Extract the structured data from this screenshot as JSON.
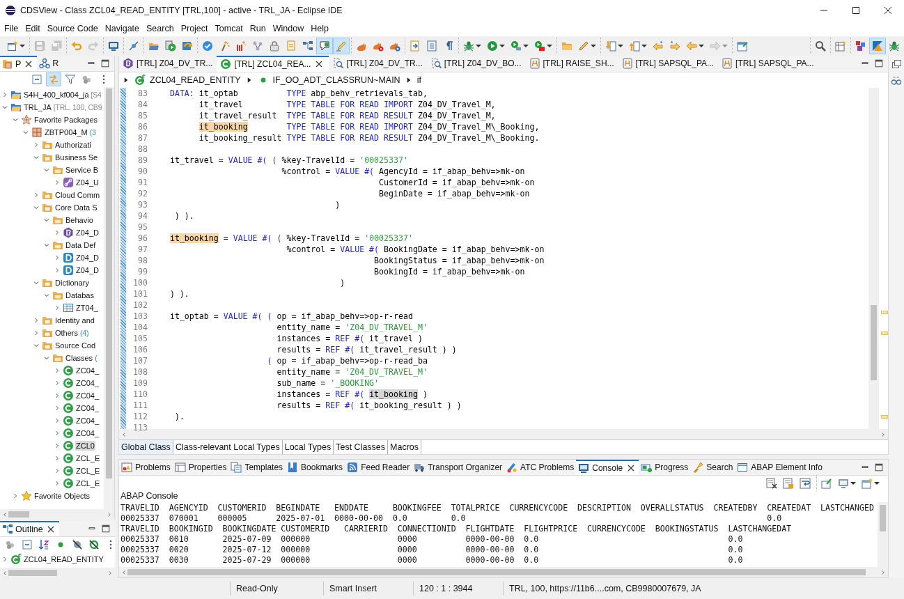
{
  "window": {
    "title": "CDSView - Class ZCL04_READ_ENTITY [TRL,100] - active - TRL_JA - Eclipse IDE"
  },
  "menu": [
    "File",
    "Edit",
    "Source Code",
    "Navigate",
    "Search",
    "Project",
    "Tomcat",
    "Run",
    "Window",
    "Help"
  ],
  "toolbar": {
    "left": [
      [
        {
          "kind": "new",
          "dropdown": true,
          "pressed": false,
          "disabled": false
        }
      ],
      [
        {
          "kind": "save",
          "dropdown": false,
          "pressed": false,
          "disabled": true
        },
        {
          "kind": "saveall",
          "dropdown": false,
          "pressed": false,
          "disabled": true
        }
      ],
      [
        {
          "kind": "undo",
          "dropdown": false,
          "pressed": false,
          "disabled": false
        },
        {
          "kind": "redo",
          "dropdown": false,
          "pressed": false,
          "disabled": true
        }
      ],
      [
        {
          "kind": "monitor",
          "dropdown": false,
          "pressed": false,
          "disabled": false
        }
      ],
      [
        {
          "kind": "link",
          "dropdown": false,
          "pressed": false,
          "disabled": false
        }
      ],
      [
        {
          "kind": "open",
          "dropdown": false,
          "pressed": false,
          "disabled": false
        },
        {
          "kind": "run",
          "dropdown": false,
          "pressed": false,
          "disabled": false
        },
        {
          "kind": "refresh",
          "dropdown": false,
          "pressed": false,
          "disabled": false
        }
      ],
      [
        {
          "kind": "check",
          "dropdown": false,
          "pressed": false,
          "disabled": false
        },
        {
          "kind": "wand",
          "dropdown": false,
          "pressed": false,
          "disabled": false
        },
        {
          "kind": "sparkle",
          "dropdown": false,
          "pressed": false,
          "disabled": false
        },
        {
          "kind": "cycle",
          "dropdown": false,
          "pressed": false,
          "disabled": false
        },
        {
          "kind": "lock",
          "dropdown": false,
          "pressed": false,
          "disabled": false
        },
        {
          "kind": "swap",
          "dropdown": false,
          "pressed": false,
          "disabled": false
        },
        {
          "kind": "hierarchy",
          "dropdown": false,
          "pressed": false,
          "disabled": false
        },
        {
          "kind": "comment",
          "dropdown": false,
          "pressed": true,
          "disabled": false
        },
        {
          "kind": "highlighter",
          "dropdown": false,
          "pressed": true,
          "disabled": false
        }
      ],
      [
        {
          "kind": "cat",
          "dropdown": false,
          "pressed": false,
          "disabled": false
        },
        {
          "kind": "catx",
          "dropdown": false,
          "pressed": false,
          "disabled": false
        },
        {
          "kind": "catr",
          "dropdown": false,
          "pressed": false,
          "disabled": false
        }
      ],
      [
        {
          "kind": "doc",
          "dropdown": false,
          "pressed": false,
          "disabled": false
        },
        {
          "kind": "listdoc",
          "dropdown": false,
          "pressed": false,
          "disabled": false
        },
        {
          "kind": "pilcrow",
          "dropdown": false,
          "pressed": false,
          "disabled": false
        }
      ],
      [
        {
          "kind": "bug",
          "dropdown": true,
          "pressed": false,
          "disabled": false
        },
        {
          "kind": "play",
          "dropdown": true,
          "pressed": false,
          "disabled": false
        },
        {
          "kind": "runlist",
          "dropdown": true,
          "pressed": false,
          "disabled": false
        },
        {
          "kind": "runbox",
          "dropdown": true,
          "pressed": false,
          "disabled": false
        }
      ],
      [
        {
          "kind": "folder",
          "dropdown": false,
          "pressed": false,
          "disabled": false
        },
        {
          "kind": "pen",
          "dropdown": true,
          "pressed": false,
          "disabled": false
        }
      ],
      [
        {
          "kind": "down",
          "dropdown": true,
          "pressed": false,
          "disabled": false
        },
        {
          "kind": "up",
          "dropdown": true,
          "pressed": false,
          "disabled": false
        },
        {
          "kind": "backstar",
          "dropdown": false,
          "pressed": false,
          "disabled": false
        },
        {
          "kind": "fwdstar",
          "dropdown": false,
          "pressed": false,
          "disabled": false
        },
        {
          "kind": "back",
          "dropdown": true,
          "pressed": false,
          "disabled": false
        },
        {
          "kind": "fwd",
          "dropdown": true,
          "pressed": false,
          "disabled": true
        }
      ],
      [
        {
          "kind": "pinwin",
          "dropdown": false,
          "pressed": false,
          "disabled": false
        }
      ]
    ],
    "right": [
      [
        {
          "kind": "search",
          "dropdown": false,
          "pressed": false,
          "disabled": false
        }
      ],
      [
        {
          "kind": "perspopen",
          "dropdown": false,
          "pressed": false,
          "disabled": false
        }
      ],
      [
        {
          "kind": "cubes",
          "dropdown": false,
          "pressed": false,
          "disabled": false
        },
        {
          "kind": "triangle",
          "dropdown": false,
          "pressed": true,
          "disabled": false
        },
        {
          "kind": "bug",
          "dropdown": false,
          "pressed": false,
          "disabled": false
        }
      ]
    ]
  },
  "left_panel": {
    "tabs": [
      {
        "label": "P",
        "kind": "packages",
        "selected": true
      },
      {
        "label": "R",
        "kind": "relations",
        "selected": false
      }
    ],
    "toolbar": [
      {
        "kind": "collapse",
        "pressed": false
      },
      {
        "kind": "linked",
        "pressed": true
      },
      {
        "kind": "filter",
        "pressed": false
      },
      {
        "kind": "circles",
        "pressed": false
      },
      {
        "kind": "more",
        "pressed": false
      }
    ],
    "tree": [
      {
        "label": "S4H_400_kf004_ja",
        "detail": "[S4",
        "kind": "project",
        "expanded": false,
        "selected": false
      },
      {
        "label": "TRL_JA",
        "detail": "[TRL, 100, CB9",
        "kind": "project",
        "expanded": true,
        "selected": false,
        "children": [
          {
            "label": "Favorite Packages",
            "kind": "favorites",
            "expanded": true,
            "selected": false,
            "children": [
              {
                "label": "ZBTP004_M",
                "detail": "(3",
                "kind": "package",
                "expanded": true,
                "selected": false,
                "children": [
                  {
                    "label": "Authorizati",
                    "kind": "gfolder",
                    "expanded": false,
                    "selected": false
                  },
                  {
                    "label": "Business Se",
                    "kind": "gfolder",
                    "expanded": true,
                    "selected": false,
                    "children": [
                      {
                        "label": "Service B",
                        "kind": "tfolder",
                        "expanded": true,
                        "selected": false,
                        "children": [
                          {
                            "label": "Z04_U",
                            "kind": "service",
                            "expanded": false,
                            "selected": false
                          }
                        ]
                      }
                    ]
                  },
                  {
                    "label": "Cloud Comm",
                    "kind": "gfolder",
                    "expanded": false,
                    "selected": false
                  },
                  {
                    "label": "Core Data S",
                    "kind": "gfolder",
                    "expanded": true,
                    "selected": false,
                    "children": [
                      {
                        "label": "Behavio",
                        "kind": "tfolder",
                        "expanded": true,
                        "selected": false,
                        "children": [
                          {
                            "label": "Z04_D",
                            "kind": "behavior",
                            "expanded": false,
                            "selected": false
                          }
                        ]
                      },
                      {
                        "label": "Data Def",
                        "kind": "tfolder",
                        "expanded": true,
                        "selected": false,
                        "children": [
                          {
                            "label": "Z04_D",
                            "kind": "ddl",
                            "expanded": false,
                            "selected": false
                          },
                          {
                            "label": "Z04_D",
                            "kind": "ddl",
                            "expanded": false,
                            "selected": false
                          }
                        ]
                      }
                    ]
                  },
                  {
                    "label": "Dictionary",
                    "kind": "gfolder",
                    "expanded": true,
                    "selected": false,
                    "children": [
                      {
                        "label": "Databas",
                        "kind": "tfolder",
                        "expanded": true,
                        "selected": false,
                        "children": [
                          {
                            "label": "ZT04_",
                            "kind": "table",
                            "expanded": false,
                            "selected": false
                          }
                        ]
                      }
                    ]
                  },
                  {
                    "label": "Identity and",
                    "kind": "gfolder",
                    "expanded": false,
                    "selected": false
                  },
                  {
                    "label": "Others",
                    "detail": "(4)",
                    "kind": "gfolder",
                    "expanded": false,
                    "selected": false
                  },
                  {
                    "label": "Source Cod",
                    "kind": "gfolder",
                    "expanded": true,
                    "selected": false,
                    "children": [
                      {
                        "label": "Classes",
                        "detail": "(",
                        "kind": "tfolder",
                        "expanded": true,
                        "selected": false,
                        "children": [
                          {
                            "label": "ZC04_",
                            "kind": "class",
                            "expanded": false,
                            "selected": false
                          },
                          {
                            "label": "ZC04_",
                            "kind": "class",
                            "expanded": false,
                            "selected": false
                          },
                          {
                            "label": "ZC04_",
                            "kind": "class",
                            "expanded": false,
                            "selected": false
                          },
                          {
                            "label": "ZC04_",
                            "kind": "class",
                            "expanded": false,
                            "selected": false
                          },
                          {
                            "label": "ZC04_",
                            "kind": "class",
                            "expanded": false,
                            "selected": false
                          },
                          {
                            "label": "ZC04_",
                            "kind": "class",
                            "expanded": false,
                            "selected": false
                          },
                          {
                            "label": "ZCL0",
                            "kind": "class",
                            "expanded": false,
                            "selected": true
                          },
                          {
                            "label": "ZCL_E",
                            "kind": "class",
                            "expanded": false,
                            "selected": false
                          },
                          {
                            "label": "ZCL_E",
                            "kind": "class",
                            "expanded": false,
                            "selected": false
                          },
                          {
                            "label": "ZCL_E",
                            "kind": "class",
                            "expanded": false,
                            "selected": false
                          }
                        ]
                      }
                    ]
                  }
                ]
              }
            ]
          },
          {
            "label": "Favorite Objects",
            "kind": "star",
            "expanded": false,
            "selected": false
          }
        ]
      }
    ]
  },
  "outline": {
    "tab": {
      "label": "Outline",
      "selected": true
    },
    "toolbar": [
      {
        "kind": "circles"
      },
      {
        "kind": "collapse"
      },
      {
        "kind": "sort"
      },
      {
        "kind": "greendot"
      },
      {
        "kind": "hidefld"
      },
      {
        "kind": "hidestat"
      },
      {
        "kind": "more"
      }
    ],
    "items": [
      {
        "label": "ZCL04_READ_ENTITY",
        "kind": "classf",
        "expanded": false,
        "selected": false
      }
    ]
  },
  "editor": {
    "tabs": [
      {
        "label": "[TRL] Z04_DV_TR...",
        "kind": "behavior",
        "selected": false
      },
      {
        "label": "[TRL] ZCL04_REA...",
        "kind": "class",
        "selected": true
      },
      {
        "label": "[TRL] Z04_DV_TR...",
        "kind": "cdsview",
        "selected": false
      },
      {
        "label": "[TRL] Z04_DV_BO...",
        "kind": "cdsview",
        "selected": false
      },
      {
        "label": "[TRL] RAISE_SH...",
        "kind": "sql",
        "selected": false
      },
      {
        "label": "[TRL] SAPSQL_PA...",
        "kind": "sql",
        "selected": false
      },
      {
        "label": "[TRL] SAPSQL_PA...",
        "kind": "sql",
        "selected": false
      }
    ],
    "breadcrumb": [
      {
        "label": "ZCL04_READ_ENTITY",
        "kind": "classf"
      },
      {
        "label": "IF_OO_ADT_CLASSRUN~MAIN",
        "kind": "greendot"
      },
      {
        "label": "if",
        "kind": "none"
      }
    ],
    "lines": [
      {
        "no": "83",
        "tokens": [
          {
            "kind": "k",
            "text": "    DATA:"
          },
          {
            "kind": "p",
            "text": " it_optab          "
          },
          {
            "kind": "k",
            "text": "TYPE"
          },
          {
            "kind": "p",
            "text": " abp_behv_retrievals_tab,"
          }
        ]
      },
      {
        "no": "84",
        "tokens": [
          {
            "kind": "p",
            "text": "          it_travel         "
          },
          {
            "kind": "k",
            "text": "TYPE TABLE FOR READ IMPORT"
          },
          {
            "kind": "p",
            "text": " Z04_DV_Travel_M,"
          }
        ]
      },
      {
        "no": "85",
        "tokens": [
          {
            "kind": "p",
            "text": "          it_travel_result  "
          },
          {
            "kind": "k",
            "text": "TYPE TABLE FOR READ RESULT"
          },
          {
            "kind": "p",
            "text": " Z04_DV_Travel_M,"
          }
        ]
      },
      {
        "no": "86",
        "tokens": [
          {
            "kind": "h",
            "text": "          it_booking"
          },
          {
            "kind": "k",
            "text": "        TYPE TABLE FOR READ IMPORT"
          },
          {
            "kind": "p",
            "text": " Z04_DV_Travel_M\\_Booking,"
          }
        ]
      },
      {
        "no": "87",
        "tokens": [
          {
            "kind": "p",
            "text": "          it_booking_result "
          },
          {
            "kind": "k",
            "text": "TYPE TABLE FOR READ RESULT"
          },
          {
            "kind": "p",
            "text": " Z04_DV_Travel_M\\_Booking."
          }
        ]
      },
      {
        "no": "88"
      },
      {
        "no": "89",
        "tokens": [
          {
            "kind": "p",
            "text": "    it_travel = "
          },
          {
            "kind": "k",
            "text": "VALUE #( ("
          },
          {
            "kind": "p",
            "text": " %key-TravelId = "
          },
          {
            "kind": "s",
            "text": "'00025337'"
          }
        ]
      },
      {
        "no": "90",
        "tokens": [
          {
            "kind": "p",
            "text": "                           %control = "
          },
          {
            "kind": "k",
            "text": "VALUE #("
          },
          {
            "kind": "p",
            "text": " AgencyId = if_abap_behv=>mk-on"
          }
        ]
      },
      {
        "no": "91",
        "tokens": [
          {
            "kind": "p",
            "text": "                                               CustomerId = if_abap_behv=>mk-on"
          }
        ]
      },
      {
        "no": "92",
        "tokens": [
          {
            "kind": "p",
            "text": "                                               BeginDate = if_abap_behv=>mk-on"
          }
        ]
      },
      {
        "no": "93",
        "tokens": [
          {
            "kind": "p",
            "text": "                                      )"
          }
        ]
      },
      {
        "no": "94",
        "tokens": [
          {
            "kind": "p",
            "text": "     ) )."
          }
        ]
      },
      {
        "no": "95"
      },
      {
        "no": "96",
        "tokens": [
          {
            "kind": "h",
            "text": "    it_booking"
          },
          {
            "kind": "p",
            "text": " = "
          },
          {
            "kind": "k",
            "text": "VALUE #( ("
          },
          {
            "kind": "p",
            "text": " %key-TravelId = "
          },
          {
            "kind": "s",
            "text": "'00025337'"
          }
        ]
      },
      {
        "no": "97",
        "tokens": [
          {
            "kind": "p",
            "text": "                            %control = "
          },
          {
            "kind": "k",
            "text": "VALUE #("
          },
          {
            "kind": "p",
            "text": " BookingDate = if_abap_behv=>mk-on"
          }
        ]
      },
      {
        "no": "98",
        "tokens": [
          {
            "kind": "p",
            "text": "                                              BookingStatus = if_abap_behv=>mk-on"
          }
        ]
      },
      {
        "no": "99",
        "tokens": [
          {
            "kind": "p",
            "text": "                                              BookingId = if_abap_behv=>mk-on"
          }
        ]
      },
      {
        "no": "100",
        "tokens": [
          {
            "kind": "p",
            "text": "                                       )"
          }
        ]
      },
      {
        "no": "101",
        "tokens": [
          {
            "kind": "p",
            "text": "    ) )."
          }
        ]
      },
      {
        "no": "102"
      },
      {
        "no": "103",
        "tokens": [
          {
            "kind": "p",
            "text": "    it_optab = "
          },
          {
            "kind": "k",
            "text": "VALUE #( ("
          },
          {
            "kind": "p",
            "text": " op = if_abap_behv=>op-r-read"
          }
        ]
      },
      {
        "no": "104",
        "tokens": [
          {
            "kind": "p",
            "text": "                          entity_name = "
          },
          {
            "kind": "s",
            "text": "'Z04_DV_TRAVEL_M'"
          }
        ]
      },
      {
        "no": "105",
        "tokens": [
          {
            "kind": "p",
            "text": "                          instances = "
          },
          {
            "kind": "k",
            "text": "REF #("
          },
          {
            "kind": "p",
            "text": " it_travel )"
          }
        ]
      },
      {
        "no": "106",
        "tokens": [
          {
            "kind": "p",
            "text": "                          results = "
          },
          {
            "kind": "k",
            "text": "REF #("
          },
          {
            "kind": "p",
            "text": " it_travel_result ) )"
          }
        ]
      },
      {
        "no": "107",
        "tokens": [
          {
            "kind": "k",
            "text": "                        ("
          },
          {
            "kind": "p",
            "text": " op = if_abap_behv=>op-r-read_ba"
          }
        ]
      },
      {
        "no": "108",
        "tokens": [
          {
            "kind": "p",
            "text": "                          entity_name = "
          },
          {
            "kind": "s",
            "text": "'Z04_DV_TRAVEL_M'"
          }
        ]
      },
      {
        "no": "109",
        "tokens": [
          {
            "kind": "p",
            "text": "                          sub_name = "
          },
          {
            "kind": "s",
            "text": "'_BOOKING'"
          }
        ]
      },
      {
        "no": "110",
        "tokens": [
          {
            "kind": "p",
            "text": "                          instances = "
          },
          {
            "kind": "k",
            "text": "REF #("
          },
          {
            "kind": "o",
            "text": " it_booking"
          },
          {
            "kind": "p",
            "text": " )"
          }
        ]
      },
      {
        "no": "111",
        "tokens": [
          {
            "kind": "p",
            "text": "                          results = "
          },
          {
            "kind": "k",
            "text": "REF #("
          },
          {
            "kind": "p",
            "text": " it_booking_result ) )"
          }
        ]
      },
      {
        "no": "112",
        "tokens": [
          {
            "kind": "p",
            "text": "     )."
          }
        ]
      },
      {
        "no": "113"
      }
    ],
    "bottom_tabs": [
      {
        "label": "Global Class",
        "selected": true
      },
      {
        "label": "Class-relevant Local Types",
        "selected": false
      },
      {
        "label": "Local Types",
        "selected": false
      },
      {
        "label": "Test Classes",
        "selected": false
      },
      {
        "label": "Macros",
        "selected": false
      }
    ]
  },
  "views": {
    "tabs": [
      {
        "label": "Problems",
        "kind": "problems",
        "selected": false
      },
      {
        "label": "Properties",
        "kind": "properties",
        "selected": false
      },
      {
        "label": "Templates",
        "kind": "templates",
        "selected": false
      },
      {
        "label": "Bookmarks",
        "kind": "bookmarks",
        "selected": false
      },
      {
        "label": "Feed Reader",
        "kind": "feed",
        "selected": false
      },
      {
        "label": "Transport Organizer",
        "kind": "transport",
        "selected": false
      },
      {
        "label": "ATC Problems",
        "kind": "atc",
        "selected": false
      },
      {
        "label": "Console",
        "kind": "console",
        "selected": true
      },
      {
        "label": "Progress",
        "kind": "progress",
        "selected": false
      },
      {
        "label": "Search",
        "kind": "searchv",
        "selected": false
      },
      {
        "label": "ABAP Element Info",
        "kind": "info",
        "selected": false
      }
    ],
    "toolbar": [
      [
        {
          "kind": "clear",
          "dropdown": false
        },
        {
          "kind": "scrolllock",
          "dropdown": false
        },
        {
          "kind": "wrap",
          "dropdown": false
        }
      ],
      [
        {
          "kind": "pin",
          "dropdown": false
        },
        {
          "kind": "display",
          "dropdown": true
        },
        {
          "kind": "newcon",
          "dropdown": true
        }
      ]
    ],
    "console_title": "ABAP Console",
    "console_lines": [
      "TRAVELID  AGENCYID  CUSTOMERID  BEGINDATE   ENDDATE     BOOKINGFEE  TOTALPRICE  CURRENCYCODE  DESCRIPTION  OVERALLSTATUS  CREATEDBY  CREATEDAT  LASTCHANGED",
      "00025337  070001    000005      2025-07-01  0000-00-00  0.0         0.0                                                              0.0",
      "TRAVELID  BOOKINGID  BOOKINGDATE CUSTOMERID   CARRIERID  CONNECTIONID  FLIGHTDATE  FLIGHTPRICE  CURRENCYCODE  BOOKINGSTATUS  LASTCHANGEDAT",
      "00025337  0010       2025-07-09  000000                  0000          0000-00-00  0.0                                       0.0",
      "00025337  0020       2025-07-12  000000                  0000          0000-00-00  0.0                                       0.0",
      "00025337  0030       2025-07-29  000000                  0000          0000-00-00  0.0                                       0.0"
    ]
  },
  "status_bar": [
    "Read-Only",
    "Smart Insert",
    "120 : 1 : 3944",
    "TRL, 100, https://11b6....com, CB9980007679, JA"
  ]
}
